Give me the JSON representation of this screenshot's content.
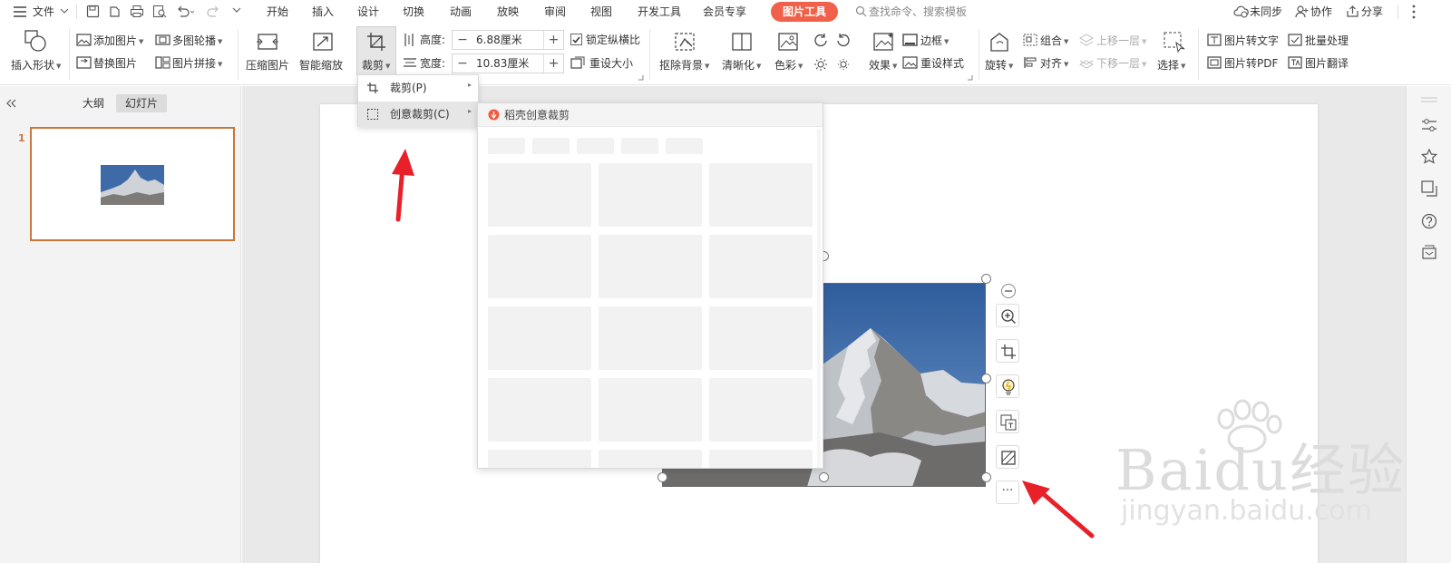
{
  "menubar": {
    "file_label": "文件",
    "tabs": [
      "开始",
      "插入",
      "设计",
      "切换",
      "动画",
      "放映",
      "审阅",
      "视图",
      "开发工具",
      "会员专享"
    ],
    "active_tab": "图片工具",
    "search_placeholder": "查找命令、搜索模板",
    "sync_label": "未同步",
    "collab_label": "协作",
    "share_label": "分享"
  },
  "ribbon": {
    "insert_shape": "插入形状",
    "add_picture": "添加图片",
    "replace_picture": "替换图片",
    "multi_carousel": "多图轮播",
    "picture_splice": "图片拼接",
    "compress_picture": "压缩图片",
    "smart_scale": "智能缩放",
    "crop": "裁剪",
    "height_label": "高度:",
    "height_value": "6.88厘米",
    "width_label": "宽度:",
    "width_value": "10.83厘米",
    "lock_ratio": "锁定纵横比",
    "reset_size": "重设大小",
    "remove_bg": "抠除背景",
    "sharpen": "清晰化",
    "color": "色彩",
    "effects": "效果",
    "border": "边框",
    "reset_style": "重设样式",
    "rotate": "旋转",
    "group": "组合",
    "align": "对齐",
    "bring_forward": "上移一层",
    "send_backward": "下移一层",
    "select": "选择",
    "pic_to_text": "图片转文字",
    "pic_to_pdf": "图片转PDF",
    "batch_process": "批量处理",
    "pic_translate": "图片翻译"
  },
  "leftpanel": {
    "tab_outline": "大纲",
    "tab_slides": "幻灯片",
    "slide_number": "1"
  },
  "crop_menu": {
    "item_crop": "裁剪(P)",
    "item_creative": "创意裁剪(C)",
    "submenu_header": "稻壳创意裁剪"
  },
  "watermark": {
    "brand": "Baidu经验",
    "url": "jingyan.baidu.com"
  },
  "float_toolbar": {
    "more": "···"
  },
  "colors": {
    "accent_tab": "#f0604a",
    "thumbnail_border": "#c8763a",
    "arrow": "#e8202a"
  }
}
